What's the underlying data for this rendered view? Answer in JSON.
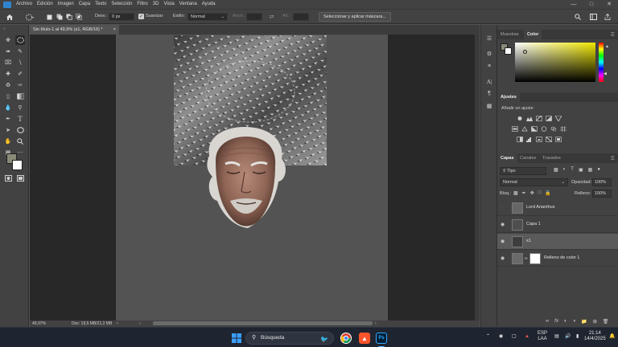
{
  "menubar": {
    "items": [
      "Archivo",
      "Edición",
      "Imagen",
      "Capa",
      "Texto",
      "Selección",
      "Filtro",
      "3D",
      "Vista",
      "Ventana",
      "Ayuda"
    ]
  },
  "optionsbar": {
    "feather_label": "Desv.:",
    "feather_value": "0 px",
    "antialias_label": "Suavizar",
    "style_label": "Estilo:",
    "style_value": "Normal",
    "width_label": "Anch.:",
    "height_label": "Alt.:",
    "select_mask_button": "Seleccionar y aplicar máscara..."
  },
  "document": {
    "tab_title": "Sin título-1 al 49,9% (s1, RGB/16) *",
    "tab_close": "×"
  },
  "statusbar": {
    "zoom": "49,97%",
    "doc_info": "Doc: 19,5 MB/21,2 MB"
  },
  "panels": {
    "top_tabs": [
      "Muestras",
      "Color"
    ],
    "adjustments_tab": "Ajustes",
    "adjustments_hint": "Añadir un ajuste",
    "layers_tabs": [
      "Capas",
      "Canales",
      "Trazados"
    ],
    "filter_kind": "Tipo",
    "blend_mode": "Normal",
    "opacity_label": "Opacidad:",
    "opacity_value": "100%",
    "lock_label": "Bloq.:",
    "fill_label": "Relleno:",
    "fill_value": "100%",
    "layers": [
      {
        "name": "Lord Arianthus",
        "visible": false,
        "selected": false
      },
      {
        "name": "Capa 1",
        "visible": true,
        "selected": false
      },
      {
        "name": "s1",
        "visible": true,
        "selected": true
      },
      {
        "name": "Relleno de color 1",
        "visible": true,
        "selected": false
      }
    ]
  },
  "taskbar": {
    "search_text": "Búsqueda",
    "lang_top": "ESP",
    "lang_bottom": "LAA",
    "time": "21:14",
    "date": "14/4/2025"
  },
  "colors": {
    "accent": "#2f84d1",
    "panel_bg": "#424242",
    "canvas_bg": "#535353",
    "workspace_bg": "#282828",
    "foreground_swatch": "#8a8a78",
    "background_swatch": "#ffffff"
  }
}
